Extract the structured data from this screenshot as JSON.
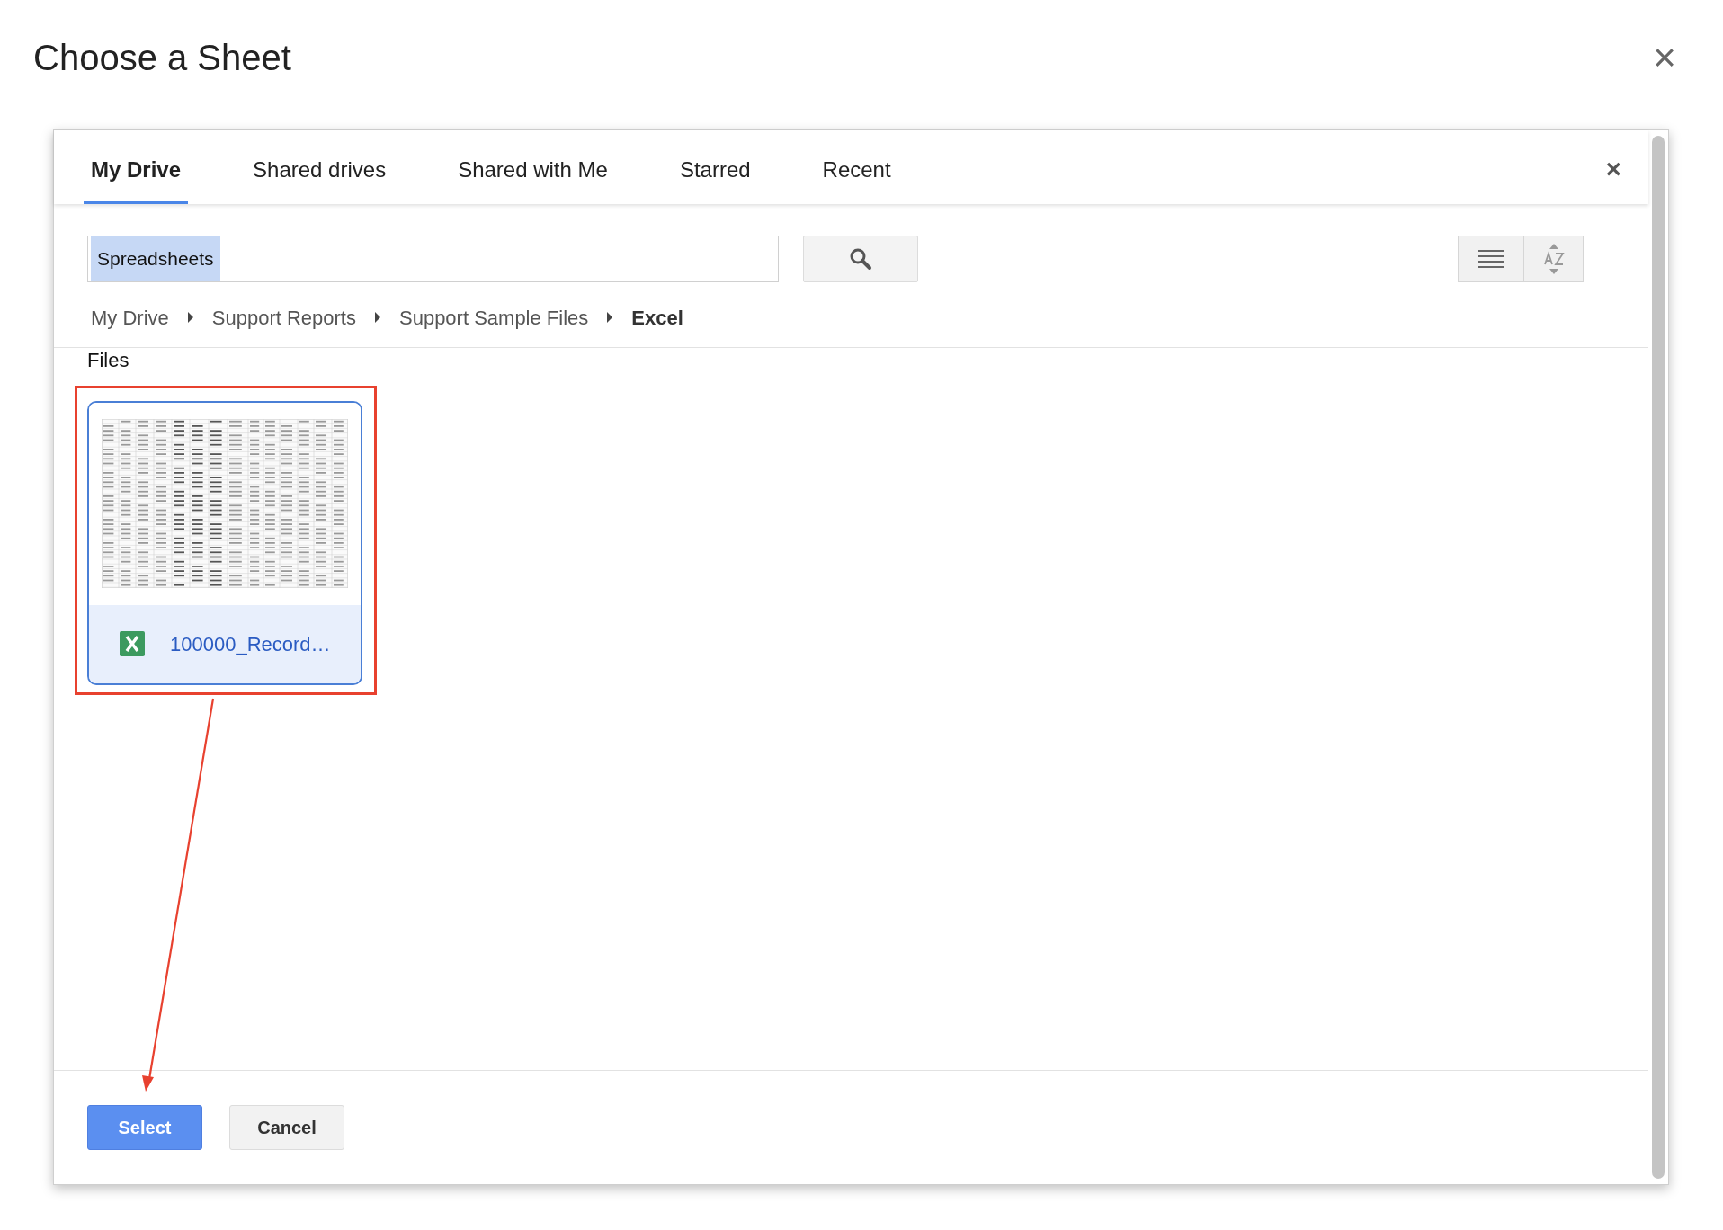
{
  "dialog": {
    "title": "Choose a Sheet",
    "close": "×"
  },
  "picker": {
    "close": "×",
    "tabs": [
      {
        "label": "My Drive",
        "selected": true
      },
      {
        "label": "Shared drives",
        "selected": false
      },
      {
        "label": "Shared with Me",
        "selected": false
      },
      {
        "label": "Starred",
        "selected": false
      },
      {
        "label": "Recent",
        "selected": false
      }
    ],
    "search": {
      "value": "Spreadsheets"
    },
    "breadcrumb": [
      {
        "label": "My Drive",
        "current": false
      },
      {
        "label": "Support Reports",
        "current": false
      },
      {
        "label": "Support Sample Files",
        "current": false
      },
      {
        "label": "Excel",
        "current": true
      }
    ],
    "section": "Files",
    "files": [
      {
        "name": "100000_Record…",
        "selected": true
      }
    ],
    "buttons": [
      {
        "label": "Select",
        "kind": "primary"
      },
      {
        "label": "Cancel",
        "kind": "secondary"
      }
    ]
  }
}
